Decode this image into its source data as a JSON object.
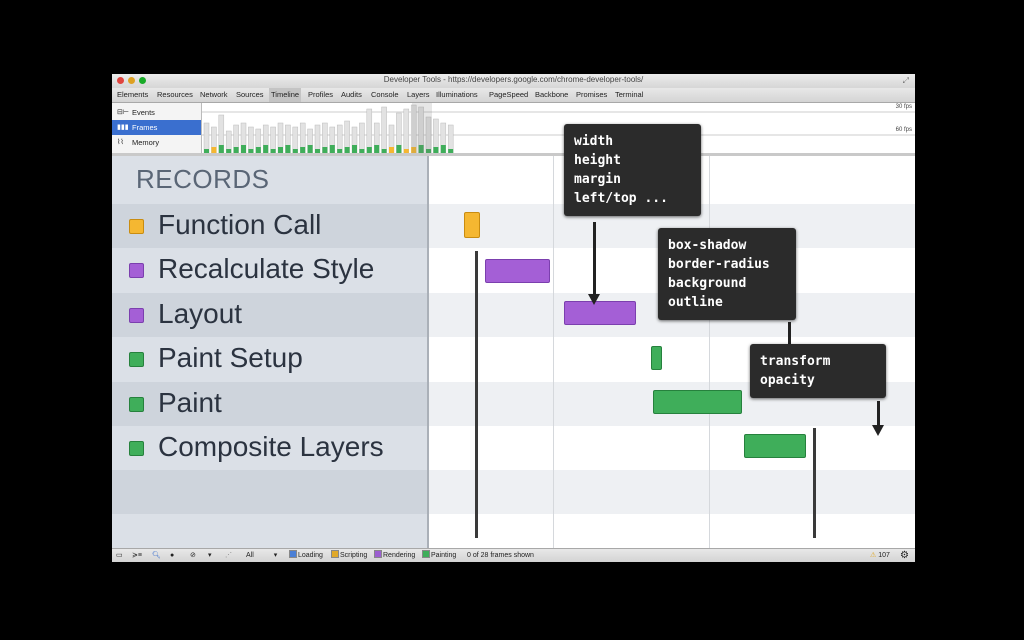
{
  "window": {
    "title": "Developer Tools - https://developers.google.com/chrome-developer-tools/"
  },
  "tabs": [
    {
      "label": "Elements"
    },
    {
      "label": "Resources"
    },
    {
      "label": "Network"
    },
    {
      "label": "Sources"
    },
    {
      "label": "Timeline"
    },
    {
      "label": "Profiles"
    },
    {
      "label": "Audits"
    },
    {
      "label": "Console"
    },
    {
      "label": "Layers"
    },
    {
      "label": "Illuminations"
    },
    {
      "label": "PageSpeed"
    },
    {
      "label": "Backbone"
    },
    {
      "label": "Promises"
    },
    {
      "label": "Terminal"
    }
  ],
  "active_tab": "Timeline",
  "overview": {
    "modes": [
      {
        "label": "Events",
        "icon": "events-icon"
      },
      {
        "label": "Frames",
        "icon": "frames-icon",
        "selected": true
      },
      {
        "label": "Memory",
        "icon": "memory-icon"
      }
    ],
    "fps_top": "30 fps",
    "fps_bottom": "60 fps"
  },
  "records": {
    "header": "RECORDS",
    "items": [
      {
        "label": "Function Call",
        "color": "#f5b731"
      },
      {
        "label": "Recalculate Style",
        "color": "#a45fd6"
      },
      {
        "label": "Layout",
        "color": "#a45fd6"
      },
      {
        "label": "Paint Setup",
        "color": "#3fae5a"
      },
      {
        "label": "Paint",
        "color": "#3fae5a"
      },
      {
        "label": "Composite Layers",
        "color": "#3fae5a"
      }
    ]
  },
  "callouts": [
    {
      "lines": [
        "width",
        "height",
        "margin",
        "left/top ..."
      ]
    },
    {
      "lines": [
        "box-shadow",
        "border-radius",
        "background",
        "outline"
      ]
    },
    {
      "lines": [
        "transform",
        "opacity"
      ]
    }
  ],
  "statusbar": {
    "filter_value": "All",
    "checkboxes": [
      {
        "label": "Loading",
        "color": "#4a7fd6"
      },
      {
        "label": "Scripting",
        "color": "#e0a92a"
      },
      {
        "label": "Rendering",
        "color": "#9c5fd0"
      },
      {
        "label": "Painting",
        "color": "#3fae5a"
      }
    ],
    "frames_text": "0 of 28 frames shown",
    "warning_count": "107"
  }
}
